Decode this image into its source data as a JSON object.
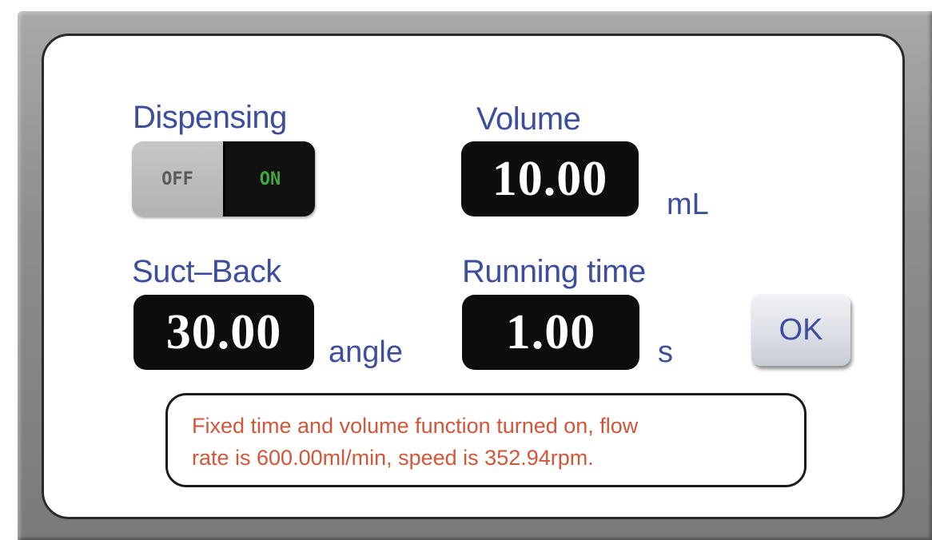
{
  "dispensing": {
    "label": "Dispensing",
    "toggle": {
      "off_label": "OFF",
      "on_label": "ON",
      "state": "ON"
    }
  },
  "volume": {
    "label": "Volume",
    "value": "10.00",
    "unit": "mL"
  },
  "suct_back": {
    "label": "Suct–Back",
    "value": "30.00",
    "unit": "angle"
  },
  "running_time": {
    "label": "Running time",
    "value": "1.00",
    "unit": "s"
  },
  "ok_button": {
    "label": "OK"
  },
  "message": {
    "line1": "Fixed time and volume function turned on, flow",
    "line2": "rate is 600.00ml/min, speed is 352.94rpm."
  },
  "colors": {
    "label": "#3d4f9c",
    "message_text": "#d2563a",
    "toggle_on": "#3ea83e",
    "value_box": "#0d0d0d"
  }
}
